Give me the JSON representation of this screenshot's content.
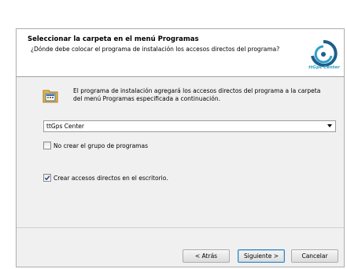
{
  "header": {
    "title": "Seleccionar la carpeta en el menú Programas",
    "subtitle": "¿Dónde debe colocar el programa de instalación los accesos directos del programa?",
    "logo_text": "ttGps Center",
    "logo_icon": "ttgps-logo-icon"
  },
  "info": {
    "icon": "program-folder-icon",
    "text": "El programa de instalación agregará los accesos directos del programa a la carpeta del menú Programas especificada a continuación."
  },
  "folder_combo": {
    "value": "ttGps Center",
    "arrow_icon": "chevron-down-icon"
  },
  "options": {
    "no_group_label": "No crear el grupo de programas",
    "no_group_checked": false,
    "desktop_label": "Crear accesos directos en el escritorio.",
    "desktop_checked": true
  },
  "buttons": {
    "back": "< Atrás",
    "next": "Siguiente >",
    "cancel": "Cancelar"
  },
  "colors": {
    "accent": "#3c7fb1",
    "logo_blue": "#2ea0c8"
  }
}
